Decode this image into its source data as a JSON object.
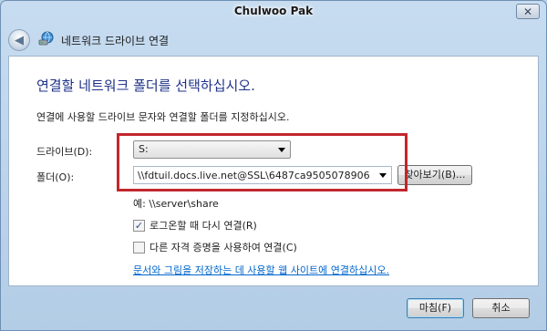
{
  "window": {
    "title": "Chulwoo Pak",
    "close_glyph": "✕"
  },
  "nav": {
    "back_glyph": "◀",
    "wizard_title": "네트워크 드라이브 연결",
    "wizard_icon": "network-drive-icon"
  },
  "main": {
    "heading": "연결할 네트워크 폴더를 선택하십시오.",
    "instruction": "연결에 사용할 드라이브 문자와 연결할 폴더를 지정하십시오.",
    "drive_label": "드라이브(D):",
    "drive_value": "S:",
    "folder_label": "폴더(O):",
    "folder_value": "\\\\fdtuil.docs.live.net@SSL\\6487ca9505078906\\",
    "browse_label": "찾아보기(B)...",
    "example_text": "예: \\\\server\\share",
    "reconnect_label": "로그온할 때 다시 연결(R)",
    "reconnect_checked": true,
    "reconnect_glyph": "✓",
    "credentials_label": "다른 자격 증명을 사용하여 연결(C)",
    "credentials_checked": false,
    "link_text": "문서와 그림을 저장하는 데 사용할 웹 사이트에 연결하십시오."
  },
  "footer": {
    "finish_label": "마침(F)",
    "cancel_label": "취소"
  },
  "colors": {
    "heading": "#1e3287",
    "link": "#0066cc",
    "highlight": "#c1272d"
  }
}
